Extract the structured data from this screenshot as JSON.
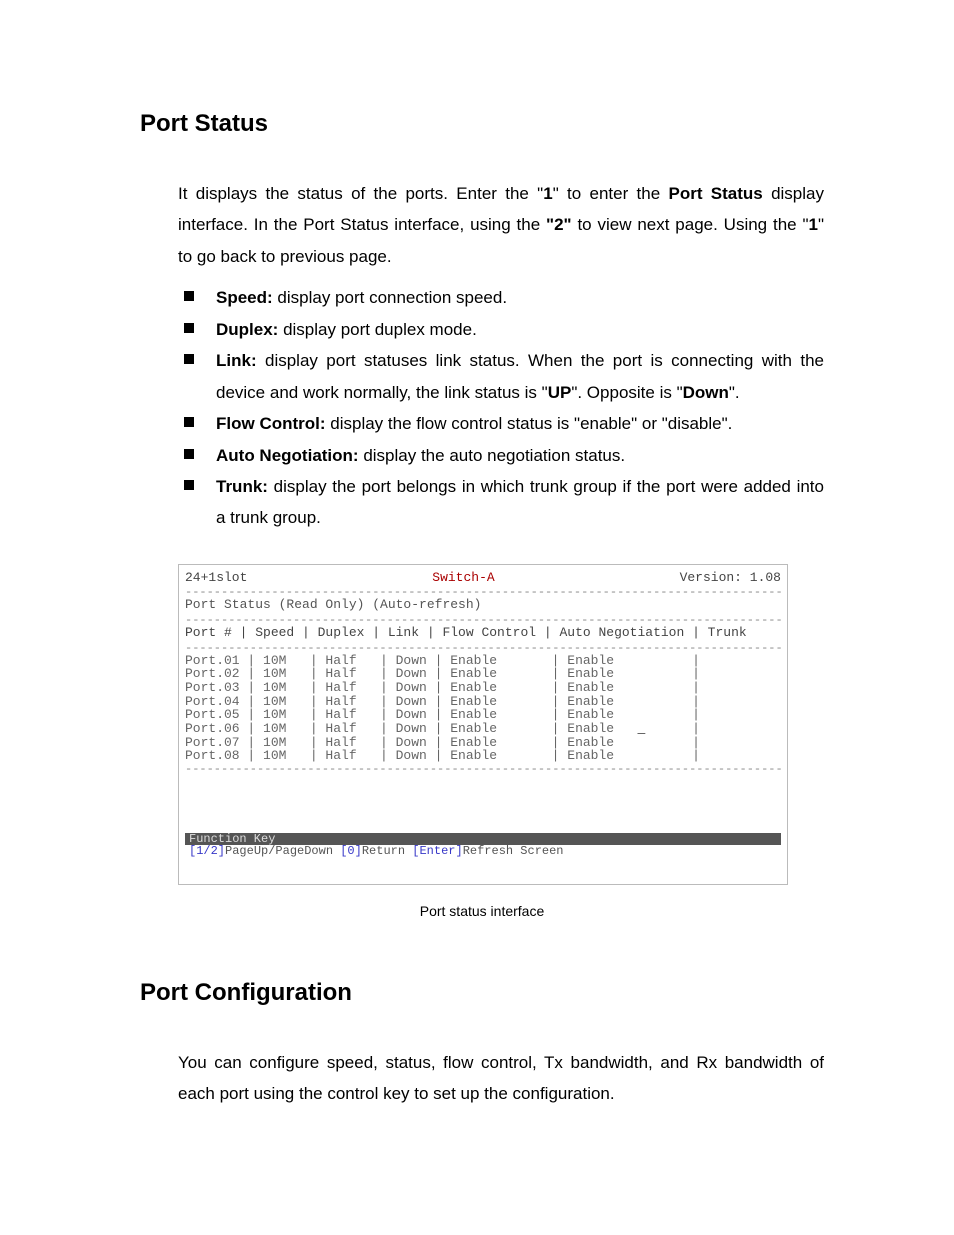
{
  "section1": {
    "title": "Port Status",
    "intro_parts": {
      "p1a": "It displays the status of the ports. Enter the \"",
      "p1b": "1",
      "p1c": "\" to enter the ",
      "p1d": "Port Status",
      "p1e": " display interface. In the Port Status interface, using the ",
      "p1f": "\"2\"",
      "p1g": " to view next page. Using the \"",
      "p1h": "1",
      "p1i": "\" to go back to previous page."
    },
    "bullets": [
      {
        "name": "Speed:",
        "desc": " display port connection speed."
      },
      {
        "name": "Duplex:",
        "desc": " display port duplex mode."
      },
      {
        "name": "Link:",
        "desc_a": " display port statuses link status. When the port is connecting with the device and work normally, the link status is \"",
        "k1": "UP",
        "desc_b": "\". Opposite is \"",
        "k2": "Down",
        "desc_c": "\"."
      },
      {
        "name": "Flow Control:",
        "desc": " display the flow control status is \"enable\" or \"disable\"."
      },
      {
        "name": "Auto Negotiation:",
        "desc": " display the auto negotiation status."
      },
      {
        "name": "Trunk:",
        "desc": " display the port belongs in which trunk group if the port were added into a trunk group."
      }
    ]
  },
  "terminal": {
    "top_left": "24+1slot",
    "top_center": "Switch-A",
    "top_right": "Version: 1.08",
    "subtitle": "Port Status (Read Only) (Auto-refresh)",
    "header": "Port # | Speed | Duplex | Link | Flow Control | Auto Negotiation | Trunk",
    "rows": [
      {
        "p": "Port.01",
        "s": "10M",
        "d": "Half",
        "l": "Down",
        "f": "Enable",
        "a": "Enable",
        "t": ""
      },
      {
        "p": "Port.02",
        "s": "10M",
        "d": "Half",
        "l": "Down",
        "f": "Enable",
        "a": "Enable",
        "t": ""
      },
      {
        "p": "Port.03",
        "s": "10M",
        "d": "Half",
        "l": "Down",
        "f": "Enable",
        "a": "Enable",
        "t": ""
      },
      {
        "p": "Port.04",
        "s": "10M",
        "d": "Half",
        "l": "Down",
        "f": "Enable",
        "a": "Enable",
        "t": ""
      },
      {
        "p": "Port.05",
        "s": "10M",
        "d": "Half",
        "l": "Down",
        "f": "Enable",
        "a": "Enable",
        "t": ""
      },
      {
        "p": "Port.06",
        "s": "10M",
        "d": "Half",
        "l": "Down",
        "f": "Enable",
        "a": "Enable",
        "t": ""
      },
      {
        "p": "Port.07",
        "s": "10M",
        "d": "Half",
        "l": "Down",
        "f": "Enable",
        "a": "Enable",
        "t": ""
      },
      {
        "p": "Port.08",
        "s": "10M",
        "d": "Half",
        "l": "Down",
        "f": "Enable",
        "a": "Enable",
        "t": ""
      }
    ],
    "func_label": " Function Key ",
    "func_keys": {
      "k1": "[1/2]",
      "t1": "PageUp/PageDown ",
      "k2": "[0]",
      "t2": "Return ",
      "k3": "[Enter]",
      "t3": "Refresh Screen"
    },
    "caption": "Port status interface"
  },
  "section2": {
    "title": "Port Configuration",
    "text": "You can configure speed, status, flow control, Tx bandwidth, and Rx bandwidth of each port using the control key to set up the configuration."
  }
}
